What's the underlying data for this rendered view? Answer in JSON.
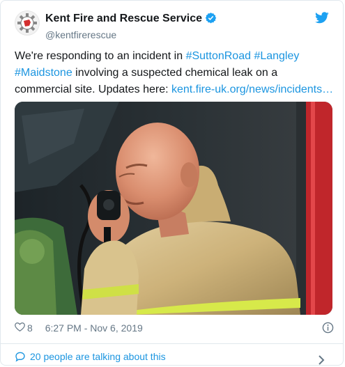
{
  "account": {
    "display_name": "Kent Fire and Rescue Service",
    "handle": "@kentfirerescue"
  },
  "tweet": {
    "text_before": "We're responding to an incident in ",
    "hashtag_1": "#SuttonRoad",
    "hashtag_2": "#Langley",
    "hashtag_3": "#Maidstone",
    "text_after": " involving a suspected chemical leak on a commercial site. Updates here: ",
    "link": "kent.fire-uk.org/news/incidents…"
  },
  "meta": {
    "like_count": "8",
    "time": "6:27 PM - Nov 6, 2019"
  },
  "footer": {
    "talking_label": "20 people are talking about this"
  },
  "colors": {
    "accent": "#1b95e0",
    "secondary_text": "#657786",
    "twitter_blue": "#1da1f2",
    "brand_red": "#d32f2f"
  },
  "icons": [
    "kfrs-logo",
    "verified-badge-icon",
    "twitter-bird-icon",
    "heart-icon",
    "info-icon",
    "speech-bubble-icon",
    "chevron-right-icon"
  ]
}
